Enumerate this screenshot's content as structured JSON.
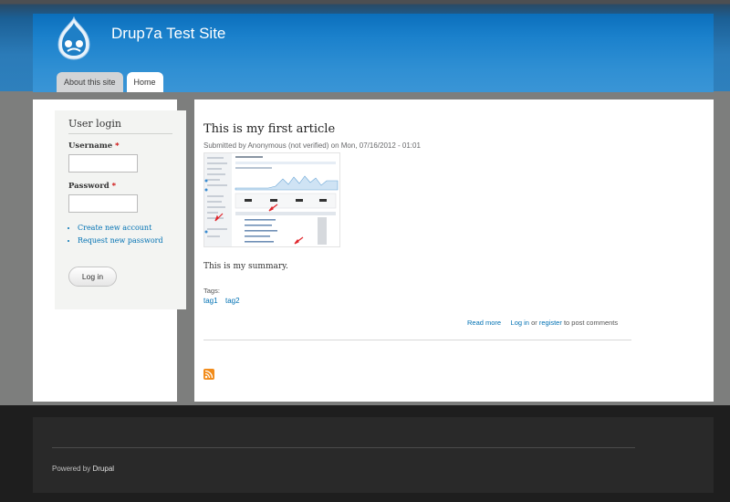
{
  "header": {
    "site_name": "Drup7a Test Site",
    "logo_icon": "drupal-drop-logo",
    "tabs": [
      {
        "label": "About this site",
        "active": false
      },
      {
        "label": "Home",
        "active": true
      }
    ]
  },
  "sidebar": {
    "login": {
      "title": "User login",
      "username_label": "Username",
      "password_label": "Password",
      "required_marker": "*",
      "username_value": "",
      "password_value": "",
      "links": [
        "Create new account",
        "Request new password"
      ],
      "button_label": "Log in"
    }
  },
  "article": {
    "title": "This is my first article",
    "submitted": "Submitted by Anonymous (not verified) on Mon, 07/16/2012 - 01:01",
    "summary": "This is my summary.",
    "tags_label": "Tags:",
    "tags": [
      "tag1",
      "tag2"
    ],
    "read_more": "Read more",
    "login_link": "Log in",
    "or_text": "or",
    "register_link": "register",
    "post_comments_text": "to post comments",
    "feed_icon": "rss-feed-icon"
  },
  "footer": {
    "powered_prefix": "Powered by",
    "powered_brand": "Drupal"
  },
  "colors": {
    "link": "#0071b3",
    "header_blue": "#1b81cc",
    "required": "#cc0000"
  }
}
